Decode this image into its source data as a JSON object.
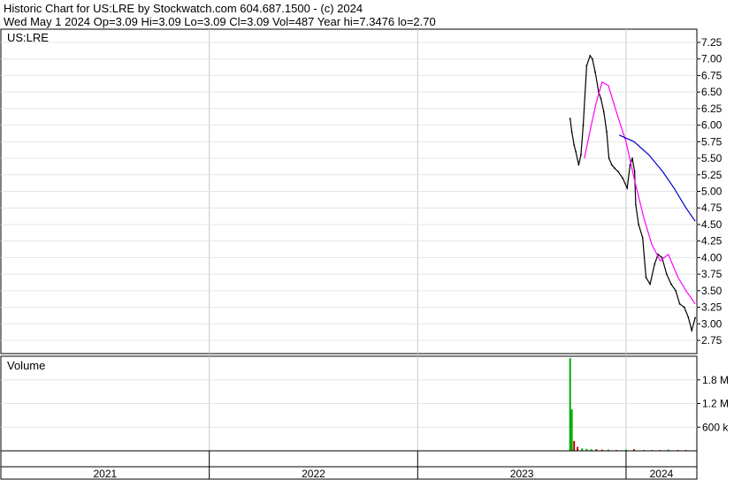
{
  "header": {
    "line1": "Historic Chart for US:LRE by Stockwatch.com 604.687.1500 - (c) 2024",
    "line2": "Wed May  1 2024   Op=3.09  Hi=3.09  Lo=3.09  Cl=3.09  Vol=487  Year hi=7.3476  lo=2.70"
  },
  "price_panel": {
    "label": "US:LRE"
  },
  "volume_panel": {
    "label": "Volume"
  },
  "colors": {
    "price": "#000000",
    "down_tick": "#cc0000",
    "ma_short": "#ff00ff",
    "ma_long": "#0000cc",
    "volume_up": "#00aa00",
    "volume_down": "#cc0000",
    "grid": "#c8c8c8"
  },
  "chart_data": [
    {
      "type": "line",
      "title": "US:LRE",
      "y_ticks": [
        "7.25",
        "7.00",
        "6.75",
        "6.50",
        "6.25",
        "6.00",
        "5.75",
        "5.50",
        "5.25",
        "5.00",
        "4.75",
        "4.50",
        "4.25",
        "4.00",
        "3.75",
        "3.50",
        "3.25",
        "3.00",
        "2.75"
      ],
      "ylim": [
        2.55,
        7.45
      ],
      "x_ticks": [
        "2021",
        "2022",
        "2023",
        "2024"
      ],
      "xlim": [
        "2021-01-01",
        "2024-05-04"
      ],
      "series": [
        {
          "kind": "price",
          "x": [
            "2023-09-25",
            "2023-09-28",
            "2023-10-02",
            "2023-10-05",
            "2023-10-10",
            "2023-10-14",
            "2023-10-18",
            "2023-10-24",
            "2023-10-30",
            "2023-11-03",
            "2023-11-08",
            "2023-11-14",
            "2023-11-18",
            "2023-11-23",
            "2023-11-28",
            "2023-12-02",
            "2023-12-07",
            "2023-12-12",
            "2023-12-18",
            "2023-12-26",
            "2024-01-03",
            "2024-01-08",
            "2024-01-12",
            "2024-01-16",
            "2024-01-18",
            "2024-01-23",
            "2024-01-30",
            "2024-02-05",
            "2024-02-12",
            "2024-02-20",
            "2024-02-26",
            "2024-03-04",
            "2024-03-12",
            "2024-03-20",
            "2024-03-28",
            "2024-04-04",
            "2024-04-12",
            "2024-04-19",
            "2024-04-25",
            "2024-05-01"
          ],
          "y": [
            6.1,
            5.9,
            5.7,
            5.6,
            5.4,
            5.55,
            6.0,
            6.9,
            7.05,
            7.0,
            6.8,
            6.5,
            6.4,
            6.2,
            5.9,
            5.5,
            5.4,
            5.35,
            5.3,
            5.2,
            5.05,
            5.4,
            5.5,
            5.3,
            4.8,
            4.5,
            4.3,
            3.7,
            3.6,
            3.9,
            4.05,
            4.0,
            3.75,
            3.6,
            3.5,
            3.3,
            3.25,
            3.1,
            2.9,
            3.09
          ]
        },
        {
          "kind": "moving-average-short",
          "x": [
            "2023-10-20",
            "2023-11-01",
            "2023-11-10",
            "2023-11-20",
            "2023-12-01",
            "2023-12-15",
            "2024-01-01",
            "2024-01-15",
            "2024-02-01",
            "2024-02-15",
            "2024-03-01",
            "2024-03-15",
            "2024-04-01",
            "2024-04-15",
            "2024-05-01"
          ],
          "y": [
            5.5,
            6.0,
            6.35,
            6.65,
            6.6,
            6.2,
            5.75,
            5.2,
            4.6,
            4.2,
            3.95,
            4.05,
            3.7,
            3.5,
            3.3
          ]
        },
        {
          "kind": "moving-average-long",
          "x": [
            "2023-12-20",
            "2024-01-15",
            "2024-02-10",
            "2024-03-05",
            "2024-03-25",
            "2024-04-15",
            "2024-05-01"
          ],
          "y": [
            5.85,
            5.75,
            5.55,
            5.3,
            5.05,
            4.75,
            4.55
          ]
        }
      ]
    },
    {
      "type": "bar",
      "title": "Volume",
      "y_ticks": [
        "1.8 M",
        "1.2 M",
        "600 k"
      ],
      "ylim": [
        0,
        2.4
      ],
      "x": [
        "2023-09-25",
        "2023-09-28",
        "2023-10-02",
        "2023-10-08",
        "2023-10-16",
        "2023-10-24",
        "2023-11-01",
        "2023-11-10",
        "2023-11-20",
        "2023-12-01",
        "2023-12-15",
        "2024-01-01",
        "2024-01-15",
        "2024-02-01",
        "2024-02-15",
        "2024-03-01",
        "2024-03-15",
        "2024-04-01",
        "2024-04-15",
        "2024-05-01"
      ],
      "values": [
        2.35,
        1.05,
        0.25,
        0.1,
        0.06,
        0.05,
        0.04,
        0.04,
        0.03,
        0.03,
        0.02,
        0.03,
        0.04,
        0.02,
        0.02,
        0.02,
        0.03,
        0.02,
        0.02,
        0.01
      ],
      "up": [
        true,
        true,
        false,
        false,
        true,
        true,
        true,
        false,
        false,
        true,
        false,
        true,
        false,
        false,
        true,
        false,
        true,
        false,
        false,
        true
      ]
    }
  ]
}
